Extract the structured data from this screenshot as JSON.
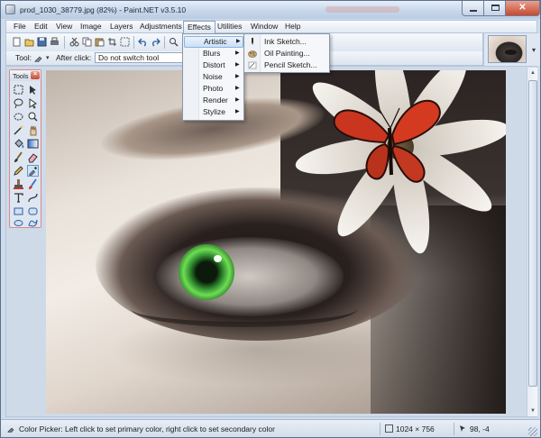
{
  "window": {
    "title": "prod_1030_38779.jpg (82%) - Paint.NET v3.5.10"
  },
  "menubar": {
    "items": [
      {
        "label": "File"
      },
      {
        "label": "Edit"
      },
      {
        "label": "View"
      },
      {
        "label": "Image"
      },
      {
        "label": "Layers"
      },
      {
        "label": "Adjustments"
      },
      {
        "label": "Effects"
      },
      {
        "label": "Utilities"
      },
      {
        "label": "Window"
      },
      {
        "label": "Help"
      }
    ],
    "active": "Effects"
  },
  "toolbar2": {
    "tool_label": "Tool:",
    "after_click_label": "After click:",
    "after_click_value": "Do not switch tool"
  },
  "tools_panel": {
    "title": "Tools",
    "close_symbol": "×"
  },
  "effects_menu": {
    "items": [
      {
        "label": "Artistic"
      },
      {
        "label": "Blurs"
      },
      {
        "label": "Distort"
      },
      {
        "label": "Noise"
      },
      {
        "label": "Photo"
      },
      {
        "label": "Render"
      },
      {
        "label": "Stylize"
      }
    ],
    "highlighted": "Artistic",
    "submenu_arrow": "▶"
  },
  "artistic_menu": {
    "items": [
      {
        "label": "Ink Sketch...",
        "icon": "ink-sketch-icon"
      },
      {
        "label": "Oil Painting...",
        "icon": "oil-painting-icon"
      },
      {
        "label": "Pencil Sketch...",
        "icon": "pencil-sketch-icon"
      }
    ]
  },
  "statusbar": {
    "text": "Color Picker: Left click to set primary color, right click to set secondary color",
    "image_size": "1024 × 756",
    "cursor_position": "98, -4"
  },
  "colors": {
    "accent": "#8eb4df",
    "close_button": "#c74a31",
    "window_frame": "#cfdcec",
    "iris": "#4fbf3c"
  }
}
